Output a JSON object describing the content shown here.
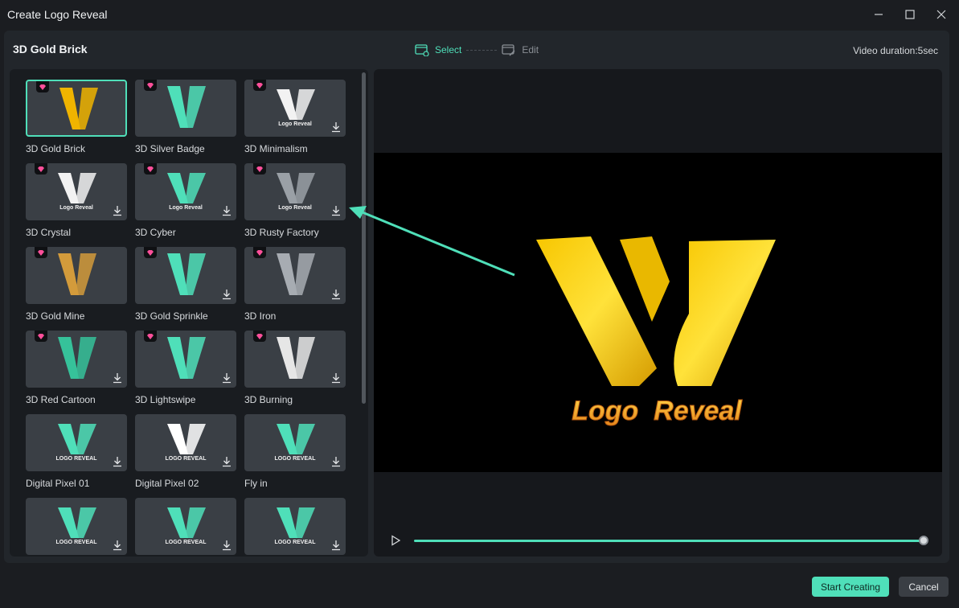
{
  "window": {
    "title": "Create Logo Reveal"
  },
  "header": {
    "template_name": "3D Gold Brick",
    "steps": [
      {
        "label": "Select",
        "icon": "film-select-icon",
        "active": true
      },
      {
        "label": "Edit",
        "icon": "film-edit-icon",
        "active": false
      }
    ],
    "duration": "Video duration:5sec"
  },
  "templates": [
    {
      "name": "3D Gold Brick",
      "thumb_text": "",
      "premium": true,
      "download": false,
      "selected": true
    },
    {
      "name": "3D Silver Badge",
      "thumb_text": "",
      "premium": true,
      "download": false,
      "selected": false
    },
    {
      "name": "3D Minimalism",
      "thumb_text": "Logo Reveal",
      "premium": true,
      "download": true,
      "selected": false
    },
    {
      "name": "3D Crystal",
      "thumb_text": "Logo Reveal",
      "premium": true,
      "download": true,
      "selected": false
    },
    {
      "name": "3D Cyber",
      "thumb_text": "Logo Reveal",
      "premium": true,
      "download": true,
      "selected": false
    },
    {
      "name": "3D Rusty Factory",
      "thumb_text": "Logo Reveal",
      "premium": true,
      "download": true,
      "selected": false
    },
    {
      "name": "3D Gold Mine",
      "thumb_text": "",
      "premium": true,
      "download": false,
      "selected": false
    },
    {
      "name": "3D Gold Sprinkle",
      "thumb_text": "",
      "premium": true,
      "download": true,
      "selected": false
    },
    {
      "name": "3D Iron",
      "thumb_text": "",
      "premium": true,
      "download": true,
      "selected": false
    },
    {
      "name": "3D Red Cartoon",
      "thumb_text": "",
      "premium": true,
      "download": true,
      "selected": false
    },
    {
      "name": "3D Lightswipe",
      "thumb_text": "",
      "premium": true,
      "download": true,
      "selected": false
    },
    {
      "name": "3D Burning",
      "thumb_text": "",
      "premium": true,
      "download": true,
      "selected": false
    },
    {
      "name": "Digital Pixel 01",
      "thumb_text": "LOGO REVEAL",
      "premium": false,
      "download": true,
      "selected": false
    },
    {
      "name": "Digital Pixel 02",
      "thumb_text": "LOGO REVEAL",
      "premium": false,
      "download": true,
      "selected": false
    },
    {
      "name": "Fly in",
      "thumb_text": "LOGO REVEAL",
      "premium": false,
      "download": true,
      "selected": false
    },
    {
      "name": "",
      "thumb_text": "LOGO REVEAL",
      "premium": false,
      "download": true,
      "selected": false
    },
    {
      "name": "",
      "thumb_text": "LOGO REVEAL",
      "premium": false,
      "download": true,
      "selected": false
    },
    {
      "name": "",
      "thumb_text": "LOGO REVEAL",
      "premium": false,
      "download": true,
      "selected": false
    }
  ],
  "preview": {
    "logo_text": "Logo  Reveal",
    "progress": 1.0
  },
  "footer": {
    "start_label": "Start Creating",
    "cancel_label": "Cancel"
  },
  "colors": {
    "accent": "#4fdfb9",
    "gold": "#f5c400",
    "premium": "#ff4f9a"
  }
}
